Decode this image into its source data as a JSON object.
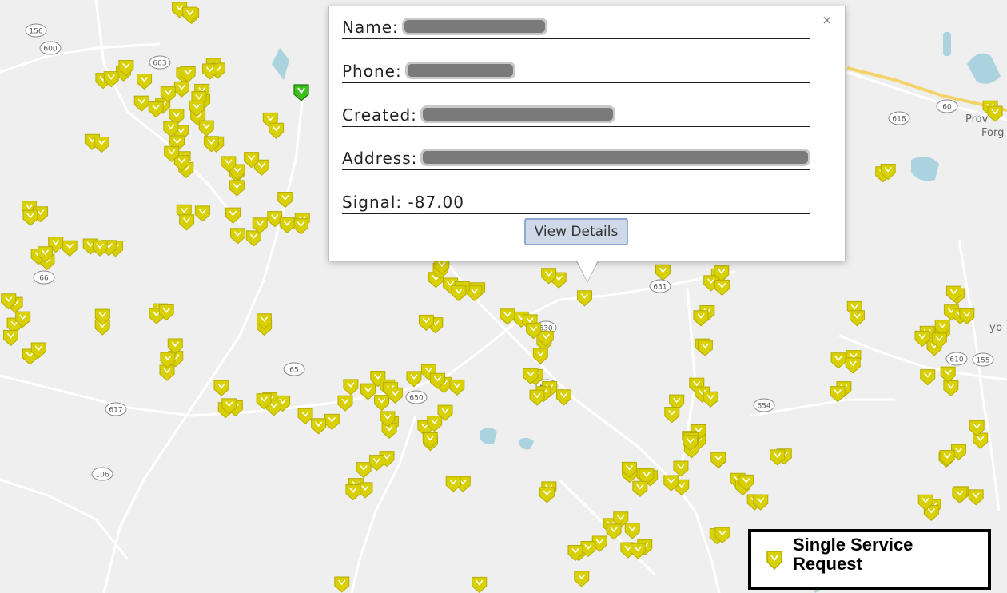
{
  "map": {
    "route_shields": [
      "156",
      "600",
      "603",
      "631",
      "630",
      "602",
      "650",
      "617",
      "106",
      "618",
      "60",
      "610",
      "155",
      "654",
      "66",
      "65"
    ],
    "place_labels": [
      "Prov",
      "Forg",
      "yb"
    ],
    "colors": {
      "background": "#efefef",
      "road": "#ffffff",
      "water": "#aad3df",
      "marker_fill": "#d9d000",
      "marker_stroke": "#b6ad00",
      "selected_marker": "#3fbf1a",
      "highway": "#f3d36a"
    }
  },
  "popup": {
    "close_label": "×",
    "name_label": "Name:",
    "phone_label": "Phone:",
    "created_label": "Created:",
    "address_label": "Address:",
    "signal_label": "Signal: -87.00",
    "button_label": "View Details"
  },
  "legend": {
    "icon": "map-marker-icon",
    "label": "Single Service Request"
  }
}
